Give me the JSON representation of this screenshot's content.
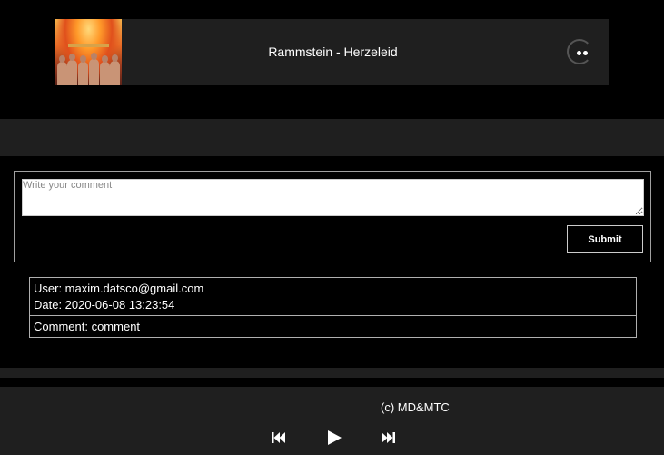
{
  "track": {
    "title": "Rammstein - Herzeleid",
    "album_art_icon": "album-cover-image",
    "more_icon": "more-options-icon"
  },
  "comment_form": {
    "placeholder": "Write your comment",
    "value": "",
    "submit_label": "Submit"
  },
  "comments": [
    {
      "user": "User: maxim.datsco@gmail.com",
      "date": "Date: 2020-06-08 13:23:54",
      "comment": "Comment: comment"
    }
  ],
  "footer": {
    "copyright": "(c) MD&MTC",
    "controls": [
      "previous-track-icon",
      "play-icon",
      "next-track-icon"
    ]
  },
  "colors": {
    "background": "#000000",
    "panel": "#1f1f1f",
    "text": "#ffffff",
    "border": "#b0b0b0"
  }
}
